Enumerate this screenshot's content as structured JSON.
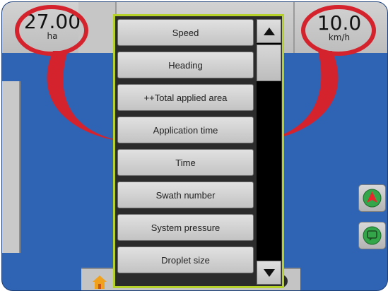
{
  "gauges": {
    "area": {
      "value": "27.00",
      "unit": "ha"
    },
    "speed": {
      "value": "10.0",
      "unit": "km/h"
    }
  },
  "menu": {
    "items": [
      "Speed",
      "Heading",
      "++Total applied area",
      "Application time",
      "Time",
      "Swath number",
      "System pressure",
      "Droplet size"
    ]
  },
  "icons": {
    "scroll_up": "up-arrow-icon",
    "scroll_down": "down-arrow-icon",
    "navigation": "navigation-arrow-icon",
    "message": "message-icon",
    "home": "home-icon",
    "settings": "gear-icon"
  },
  "colors": {
    "highlight_frame": "#b6d12a",
    "callout": "#d5232d",
    "background": "#2f63b3"
  }
}
